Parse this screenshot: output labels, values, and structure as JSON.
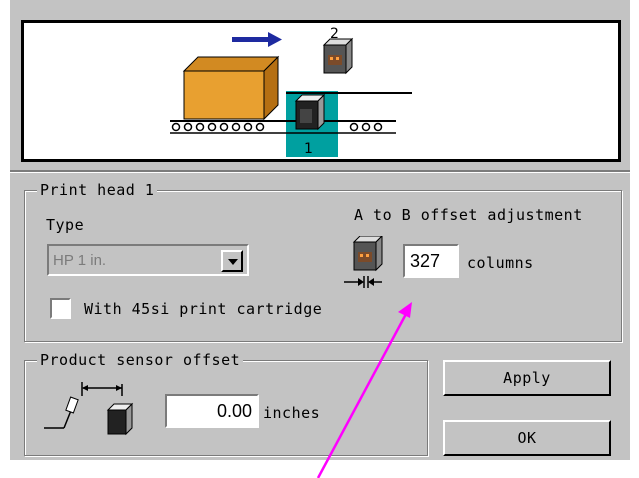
{
  "preview": {
    "head_labels": [
      "2",
      "1"
    ]
  },
  "print_head": {
    "group_title": "Print head 1",
    "type_label": "Type",
    "type_value": "HP 1 in.",
    "checkbox_label": "With 45si print cartridge",
    "checkbox_checked": false,
    "offset_title": "A to B offset adjustment",
    "offset_value": "327",
    "offset_unit": "columns"
  },
  "sensor": {
    "group_title": "Product sensor offset",
    "value": "0.00",
    "unit": "inches"
  },
  "buttons": {
    "apply": "Apply",
    "ok": "OK"
  },
  "colors": {
    "dialog_bg": "#c3c3c3",
    "highlight_teal": "#00a0a0",
    "arrow_blue": "#1e2aa0",
    "box_orange": "#e8a030",
    "annotation_magenta": "#ff00ff"
  }
}
